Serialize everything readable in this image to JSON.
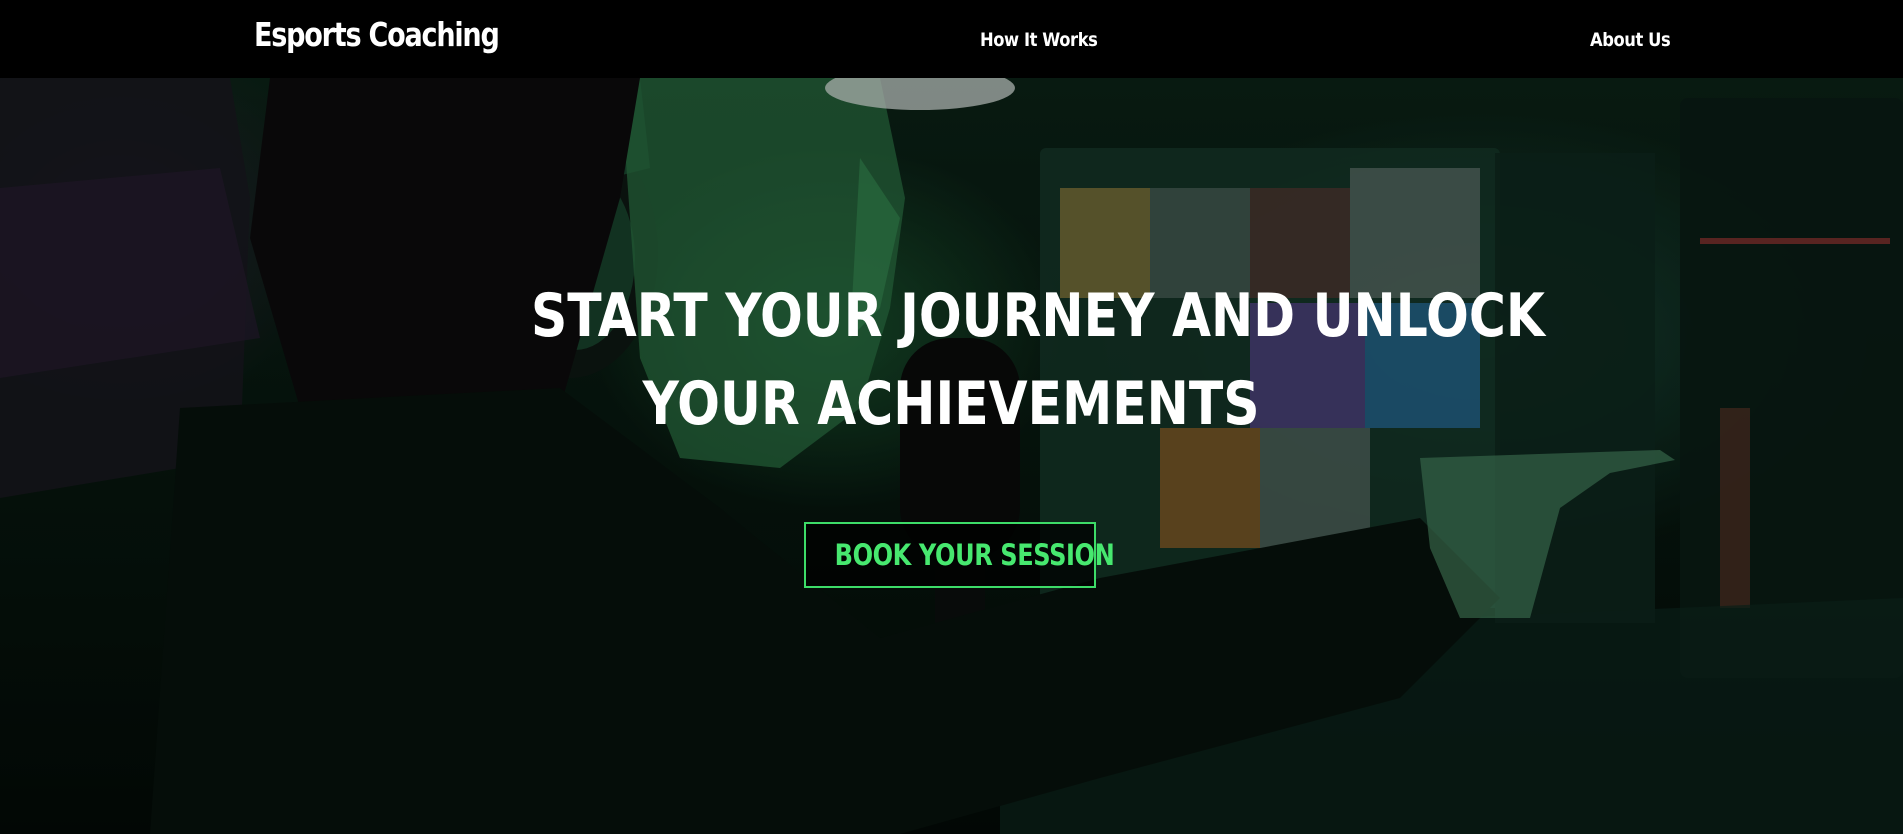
{
  "header": {
    "brand": "Esports Coaching",
    "nav": [
      {
        "label": "How It Works"
      },
      {
        "label": "About Us"
      }
    ]
  },
  "hero": {
    "headline_line1": "START YOUR JOURNEY AND UNLOCK",
    "headline_line2": "YOUR ACHIEVEMENTS",
    "cta_label": "BOOK YOUR SESSION",
    "background_image": "gamer-with-headset-at-streaming-setup",
    "accent_color": "#3ddc68"
  }
}
